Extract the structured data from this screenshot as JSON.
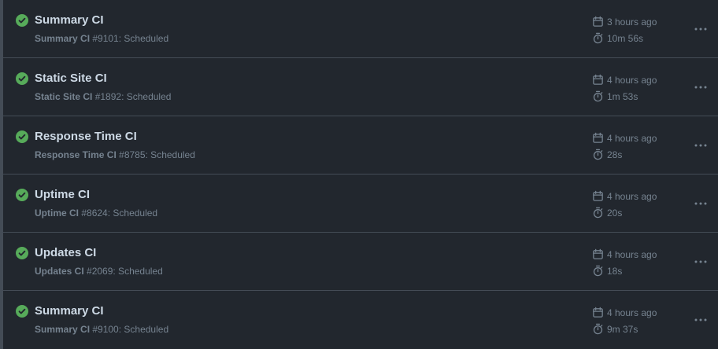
{
  "runs": [
    {
      "title": "Summary CI",
      "workflow": "Summary CI",
      "detail": " #9101: Scheduled",
      "time": "3 hours ago",
      "duration": "10m 56s",
      "status": "success"
    },
    {
      "title": "Static Site CI",
      "workflow": "Static Site CI",
      "detail": " #1892: Scheduled",
      "time": "4 hours ago",
      "duration": "1m 53s",
      "status": "success"
    },
    {
      "title": "Response Time CI",
      "workflow": "Response Time CI",
      "detail": " #8785: Scheduled",
      "time": "4 hours ago",
      "duration": "28s",
      "status": "success"
    },
    {
      "title": "Uptime CI",
      "workflow": "Uptime CI",
      "detail": " #8624: Scheduled",
      "time": "4 hours ago",
      "duration": "20s",
      "status": "success"
    },
    {
      "title": "Updates CI",
      "workflow": "Updates CI",
      "detail": " #2069: Scheduled",
      "time": "4 hours ago",
      "duration": "18s",
      "status": "success"
    },
    {
      "title": "Summary CI",
      "workflow": "Summary CI",
      "detail": " #9100: Scheduled",
      "time": "4 hours ago",
      "duration": "9m 37s",
      "status": "success"
    }
  ],
  "icons": {
    "status": "check-circle-icon",
    "time": "calendar-icon",
    "duration": "stopwatch-icon",
    "menu": "kebab-horizontal-icon"
  },
  "colors": {
    "background": "#22272e",
    "border": "#444c56",
    "success": "#57ab5a",
    "title": "#cdd9e5",
    "muted": "#768390"
  }
}
